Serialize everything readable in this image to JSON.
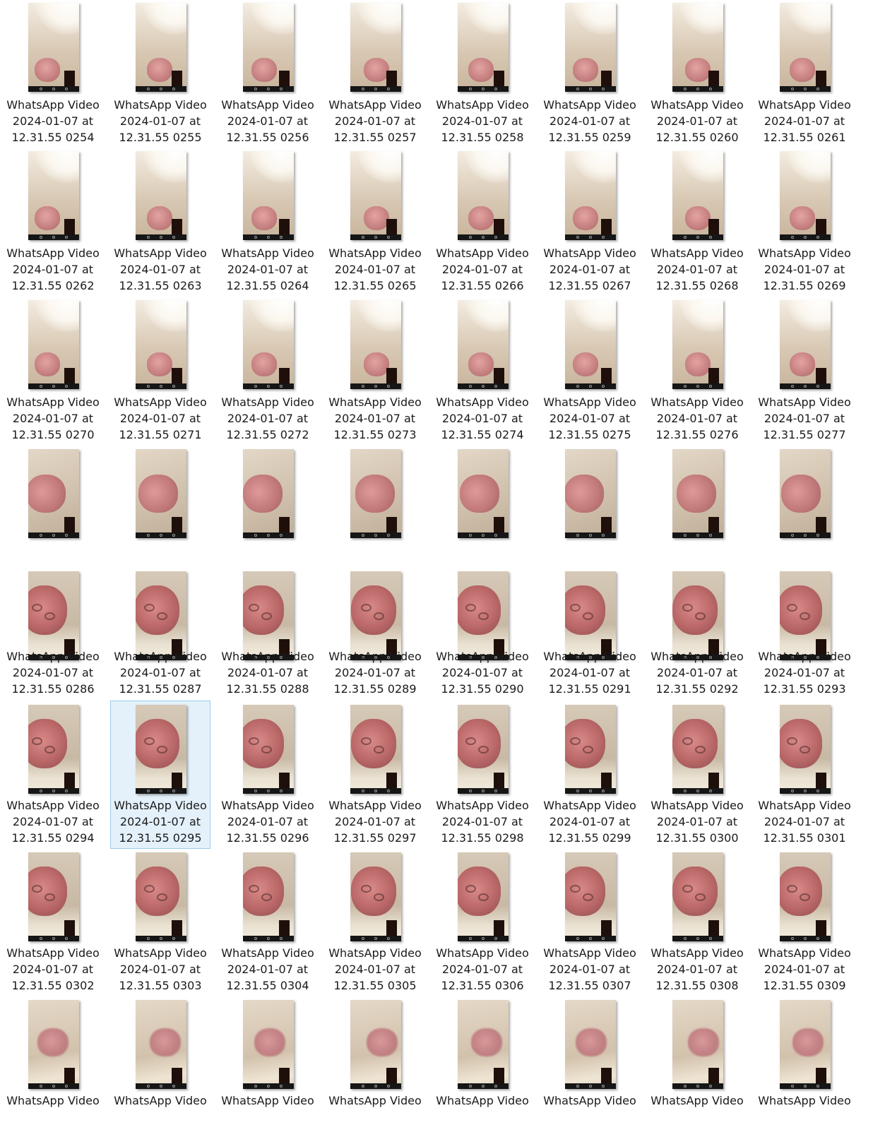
{
  "colors": {
    "selection_background": "#e4f1fb",
    "selection_border": "#99cde9",
    "text": "#1a1a1a"
  },
  "files": [
    {
      "line1": "WhatsApp Video",
      "line2": "2024-01-07 at",
      "line3": "12.31.55 0254"
    },
    {
      "line1": "WhatsApp Video",
      "line2": "2024-01-07 at",
      "line3": "12.31.55 0255"
    },
    {
      "line1": "WhatsApp Video",
      "line2": "2024-01-07 at",
      "line3": "12.31.55 0256"
    },
    {
      "line1": "WhatsApp Video",
      "line2": "2024-01-07 at",
      "line3": "12.31.55 0257"
    },
    {
      "line1": "WhatsApp Video",
      "line2": "2024-01-07 at",
      "line3": "12.31.55 0258"
    },
    {
      "line1": "WhatsApp Video",
      "line2": "2024-01-07 at",
      "line3": "12.31.55 0259"
    },
    {
      "line1": "WhatsApp Video",
      "line2": "2024-01-07 at",
      "line3": "12.31.55 0260"
    },
    {
      "line1": "WhatsApp Video",
      "line2": "2024-01-07 at",
      "line3": "12.31.55 0261"
    },
    {
      "line1": "WhatsApp Video",
      "line2": "2024-01-07 at",
      "line3": "12.31.55 0262"
    },
    {
      "line1": "WhatsApp Video",
      "line2": "2024-01-07 at",
      "line3": "12.31.55 0263"
    },
    {
      "line1": "WhatsApp Video",
      "line2": "2024-01-07 at",
      "line3": "12.31.55 0264"
    },
    {
      "line1": "WhatsApp Video",
      "line2": "2024-01-07 at",
      "line3": "12.31.55 0265"
    },
    {
      "line1": "WhatsApp Video",
      "line2": "2024-01-07 at",
      "line3": "12.31.55 0266"
    },
    {
      "line1": "WhatsApp Video",
      "line2": "2024-01-07 at",
      "line3": "12.31.55 0267"
    },
    {
      "line1": "WhatsApp Video",
      "line2": "2024-01-07 at",
      "line3": "12.31.55 0268"
    },
    {
      "line1": "WhatsApp Video",
      "line2": "2024-01-07 at",
      "line3": "12.31.55 0269"
    },
    {
      "line1": "WhatsApp Video",
      "line2": "2024-01-07 at",
      "line3": "12.31.55 0270"
    },
    {
      "line1": "WhatsApp Video",
      "line2": "2024-01-07 at",
      "line3": "12.31.55 0271"
    },
    {
      "line1": "WhatsApp Video",
      "line2": "2024-01-07 at",
      "line3": "12.31.55 0272"
    },
    {
      "line1": "WhatsApp Video",
      "line2": "2024-01-07 at",
      "line3": "12.31.55 0273"
    },
    {
      "line1": "WhatsApp Video",
      "line2": "2024-01-07 at",
      "line3": "12.31.55 0274"
    },
    {
      "line1": "WhatsApp Video",
      "line2": "2024-01-07 at",
      "line3": "12.31.55 0275"
    },
    {
      "line1": "WhatsApp Video",
      "line2": "2024-01-07 at",
      "line3": "12.31.55 0276"
    },
    {
      "line1": "WhatsApp Video",
      "line2": "2024-01-07 at",
      "line3": "12.31.55 0277"
    },
    {
      "line1": "",
      "line2": "",
      "line3": ""
    },
    {
      "line1": "",
      "line2": "",
      "line3": ""
    },
    {
      "line1": "",
      "line2": "",
      "line3": ""
    },
    {
      "line1": "",
      "line2": "",
      "line3": ""
    },
    {
      "line1": "",
      "line2": "",
      "line3": ""
    },
    {
      "line1": "",
      "line2": "",
      "line3": ""
    },
    {
      "line1": "",
      "line2": "",
      "line3": ""
    },
    {
      "line1": "",
      "line2": "",
      "line3": ""
    },
    {
      "line1": "WhatsApp Video",
      "line2": "2024-01-07 at",
      "line3": "12.31.55 0286"
    },
    {
      "line1": "WhatsApp Video",
      "line2": "2024-01-07 at",
      "line3": "12.31.55 0287"
    },
    {
      "line1": "WhatsApp Video",
      "line2": "2024-01-07 at",
      "line3": "12.31.55 0288"
    },
    {
      "line1": "WhatsApp Video",
      "line2": "2024-01-07 at",
      "line3": "12.31.55 0289"
    },
    {
      "line1": "WhatsApp Video",
      "line2": "2024-01-07 at",
      "line3": "12.31.55 0290"
    },
    {
      "line1": "WhatsApp Video",
      "line2": "2024-01-07 at",
      "line3": "12.31.55 0291"
    },
    {
      "line1": "WhatsApp Video",
      "line2": "2024-01-07 at",
      "line3": "12.31.55 0292"
    },
    {
      "line1": "WhatsApp Video",
      "line2": "2024-01-07 at",
      "line3": "12.31.55 0293"
    },
    {
      "line1": "WhatsApp Video",
      "line2": "2024-01-07 at",
      "line3": "12.31.55 0294"
    },
    {
      "line1": "WhatsApp Video",
      "line2": "2024-01-07 at",
      "line3": "12.31.55 0295",
      "selected": true
    },
    {
      "line1": "WhatsApp Video",
      "line2": "2024-01-07 at",
      "line3": "12.31.55 0296"
    },
    {
      "line1": "WhatsApp Video",
      "line2": "2024-01-07 at",
      "line3": "12.31.55 0297"
    },
    {
      "line1": "WhatsApp Video",
      "line2": "2024-01-07 at",
      "line3": "12.31.55 0298"
    },
    {
      "line1": "WhatsApp Video",
      "line2": "2024-01-07 at",
      "line3": "12.31.55 0299"
    },
    {
      "line1": "WhatsApp Video",
      "line2": "2024-01-07 at",
      "line3": "12.31.55 0300"
    },
    {
      "line1": "WhatsApp Video",
      "line2": "2024-01-07 at",
      "line3": "12.31.55 0301"
    },
    {
      "line1": "WhatsApp Video",
      "line2": "2024-01-07 at",
      "line3": "12.31.55 0302"
    },
    {
      "line1": "WhatsApp Video",
      "line2": "2024-01-07 at",
      "line3": "12.31.55 0303"
    },
    {
      "line1": "WhatsApp Video",
      "line2": "2024-01-07 at",
      "line3": "12.31.55 0304"
    },
    {
      "line1": "WhatsApp Video",
      "line2": "2024-01-07 at",
      "line3": "12.31.55 0305"
    },
    {
      "line1": "WhatsApp Video",
      "line2": "2024-01-07 at",
      "line3": "12.31.55 0306"
    },
    {
      "line1": "WhatsApp Video",
      "line2": "2024-01-07 at",
      "line3": "12.31.55 0307"
    },
    {
      "line1": "WhatsApp Video",
      "line2": "2024-01-07 at",
      "line3": "12.31.55 0308"
    },
    {
      "line1": "WhatsApp Video",
      "line2": "2024-01-07 at",
      "line3": "12.31.55 0309"
    },
    {
      "line1": "WhatsApp Video",
      "line2": "",
      "line3": ""
    },
    {
      "line1": "WhatsApp Video",
      "line2": "",
      "line3": ""
    },
    {
      "line1": "WhatsApp Video",
      "line2": "",
      "line3": ""
    },
    {
      "line1": "WhatsApp Video",
      "line2": "",
      "line3": ""
    },
    {
      "line1": "WhatsApp Video",
      "line2": "",
      "line3": ""
    },
    {
      "line1": "WhatsApp Video",
      "line2": "",
      "line3": ""
    },
    {
      "line1": "WhatsApp Video",
      "line2": "",
      "line3": ""
    },
    {
      "line1": "WhatsApp Video",
      "line2": "",
      "line3": ""
    }
  ]
}
